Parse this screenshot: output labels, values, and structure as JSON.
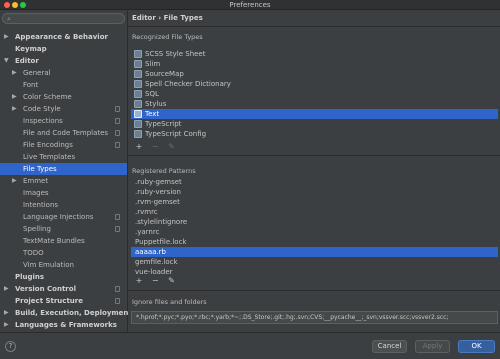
{
  "window": {
    "title": "Preferences"
  },
  "breadcrumb": {
    "parent": "Editor",
    "separator": "›",
    "current": "File Types"
  },
  "sidebar": {
    "items": [
      {
        "label": "Appearance & Behavior",
        "arrow": "▶",
        "bold": true,
        "indent": 0
      },
      {
        "label": "Keymap",
        "arrow": "",
        "bold": true,
        "indent": 0
      },
      {
        "label": "Editor",
        "arrow": "▼",
        "bold": true,
        "indent": 0
      },
      {
        "label": "General",
        "arrow": "▶",
        "bold": false,
        "indent": 1
      },
      {
        "label": "Font",
        "arrow": "",
        "bold": false,
        "indent": 1
      },
      {
        "label": "Color Scheme",
        "arrow": "▶",
        "bold": false,
        "indent": 1
      },
      {
        "label": "Code Style",
        "arrow": "▶",
        "bold": false,
        "indent": 1,
        "project": true
      },
      {
        "label": "Inspections",
        "arrow": "",
        "bold": false,
        "indent": 1,
        "project": true
      },
      {
        "label": "File and Code Templates",
        "arrow": "",
        "bold": false,
        "indent": 1,
        "project": true
      },
      {
        "label": "File Encodings",
        "arrow": "",
        "bold": false,
        "indent": 1,
        "project": true
      },
      {
        "label": "Live Templates",
        "arrow": "",
        "bold": false,
        "indent": 1
      },
      {
        "label": "File Types",
        "arrow": "",
        "bold": false,
        "indent": 1,
        "selected": true
      },
      {
        "label": "Emmet",
        "arrow": "▶",
        "bold": false,
        "indent": 1
      },
      {
        "label": "Images",
        "arrow": "",
        "bold": false,
        "indent": 1
      },
      {
        "label": "Intentions",
        "arrow": "",
        "bold": false,
        "indent": 1
      },
      {
        "label": "Language Injections",
        "arrow": "",
        "bold": false,
        "indent": 1,
        "project": true
      },
      {
        "label": "Spelling",
        "arrow": "",
        "bold": false,
        "indent": 1,
        "project": true
      },
      {
        "label": "TextMate Bundles",
        "arrow": "",
        "bold": false,
        "indent": 1
      },
      {
        "label": "TODO",
        "arrow": "",
        "bold": false,
        "indent": 1
      },
      {
        "label": "Vim Emulation",
        "arrow": "",
        "bold": false,
        "indent": 1
      },
      {
        "label": "Plugins",
        "arrow": "",
        "bold": true,
        "indent": 0
      },
      {
        "label": "Version Control",
        "arrow": "▶",
        "bold": true,
        "indent": 0,
        "project": true
      },
      {
        "label": "Project Structure",
        "arrow": "",
        "bold": true,
        "indent": 0,
        "project": true
      },
      {
        "label": "Build, Execution, Deployment",
        "arrow": "▶",
        "bold": true,
        "indent": 0
      },
      {
        "label": "Languages & Frameworks",
        "arrow": "▶",
        "bold": true,
        "indent": 0
      }
    ]
  },
  "recognized": {
    "title": "Recognized File Types",
    "items": [
      {
        "label": "SCSS Style Sheet"
      },
      {
        "label": "Slim"
      },
      {
        "label": "SourceMap"
      },
      {
        "label": "Spell Checker Dictionary"
      },
      {
        "label": "SQL"
      },
      {
        "label": "Stylus"
      },
      {
        "label": "Text",
        "selected": true
      },
      {
        "label": "TypeScript"
      },
      {
        "label": "TypeScript Config"
      }
    ],
    "toolbar": {
      "add": "+",
      "remove": "−",
      "edit": "✎"
    }
  },
  "patterns": {
    "title": "Registered Patterns",
    "items": [
      {
        "label": ".ruby-gemset"
      },
      {
        "label": ".ruby-version"
      },
      {
        "label": ".rvm-gemset"
      },
      {
        "label": ".rvmrc"
      },
      {
        "label": ".stylelintignore"
      },
      {
        "label": ".yarnrc"
      },
      {
        "label": "Puppetfile.lock"
      },
      {
        "label": "aaaaa.rb",
        "selected": true
      },
      {
        "label": "gemfile.lock"
      },
      {
        "label": "vue-loader"
      }
    ],
    "toolbar": {
      "add": "+",
      "remove": "−",
      "edit": "✎"
    }
  },
  "ignore": {
    "title": "Ignore files and folders",
    "value": "*.hprof;*.pyc;*.pyo;*.rbc;*.yarb;*~;.DS_Store;.git;.hg;.svn;CVS;__pycache__;_svn;vssver.scc;vssver2.scc;"
  },
  "footer": {
    "help": "?",
    "cancel": "Cancel",
    "apply": "Apply",
    "ok": "OK"
  },
  "colors": {
    "accent": "#2f65ca",
    "background": "#3c3f41",
    "primary_button": "#365f9e"
  }
}
